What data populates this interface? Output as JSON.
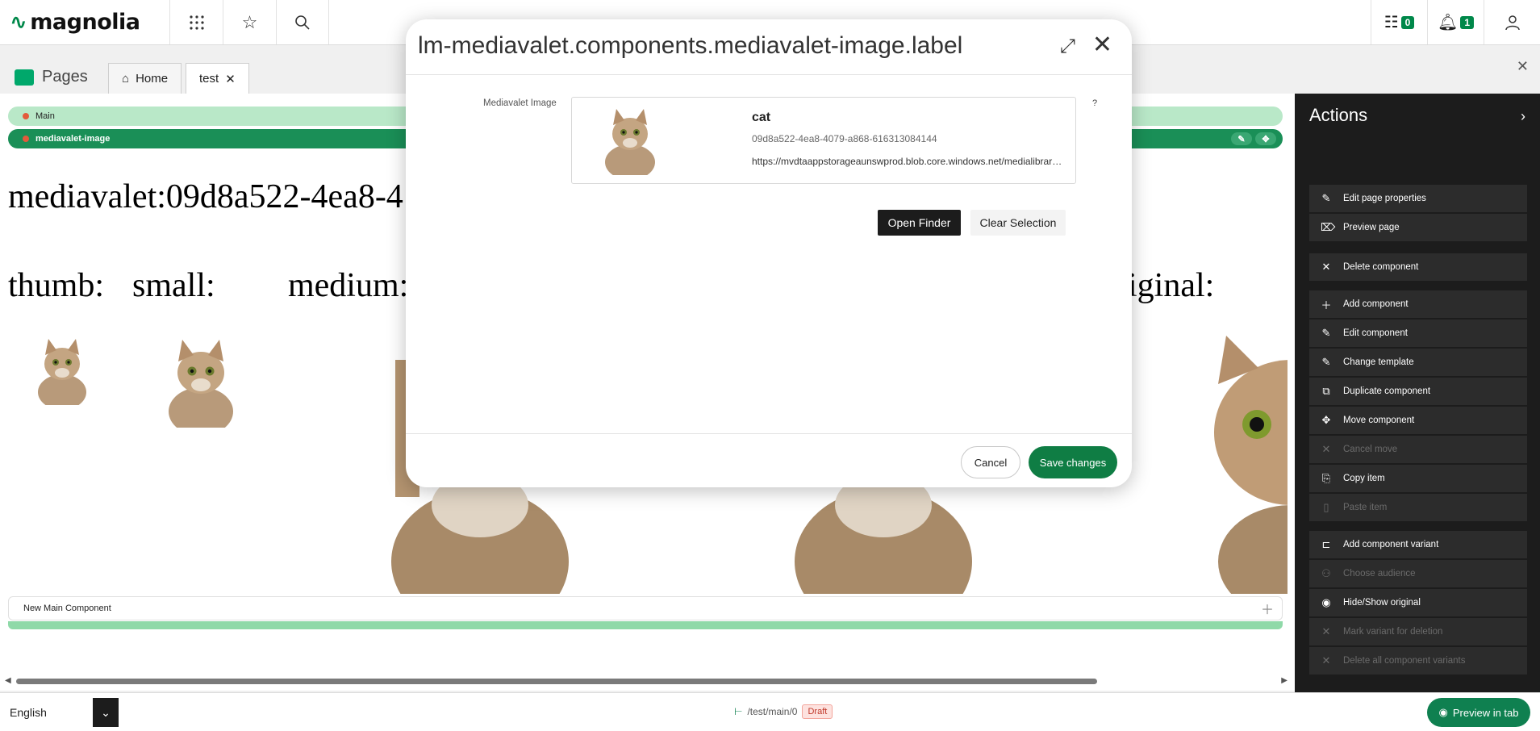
{
  "topbar": {
    "logo_text": "magnolia",
    "tasks_count": "0",
    "notifications_count": "1"
  },
  "tabs": {
    "app_title": "Pages",
    "home_label": "Home",
    "test_label": "test"
  },
  "canvas": {
    "main_area_label": "Main",
    "component_label": "mediavalet-image",
    "mediavalet_text": "mediavalet:09d8a522-4ea8-4",
    "labels": {
      "thumb": "thumb:",
      "small": "small:",
      "medium": "medium:",
      "original": "iginal:"
    },
    "new_component_label": "New Main Component"
  },
  "dialog": {
    "title": "lm-mediavalet.components.mediavalet-image.label",
    "field_label": "Mediavalet Image",
    "help": "?",
    "asset_title": "cat",
    "asset_id": "09d8a522-4ea8-4079-a868-616313084144",
    "asset_url": "https://mvdtaappstorageaunswprod.blob.core.windows.net/medialibrary/cat.jpg",
    "open_finder": "Open Finder",
    "clear_selection": "Clear Selection",
    "cancel": "Cancel",
    "save": "Save changes"
  },
  "actions": {
    "title": "Actions",
    "group1": [
      {
        "label": "Edit page properties",
        "icon": "pencil-icon"
      },
      {
        "label": "Preview page",
        "icon": "tag-icon"
      }
    ],
    "group2": [
      {
        "label": "Delete component",
        "icon": "close-icon"
      }
    ],
    "group3": [
      {
        "label": "Add component",
        "icon": "plus-icon"
      },
      {
        "label": "Edit component",
        "icon": "pencil-icon"
      },
      {
        "label": "Change template",
        "icon": "pencil-icon"
      },
      {
        "label": "Duplicate component",
        "icon": "duplicate-icon"
      },
      {
        "label": "Move component",
        "icon": "move-icon"
      },
      {
        "label": "Cancel move",
        "icon": "close-icon"
      },
      {
        "label": "Copy item",
        "icon": "copy-icon"
      },
      {
        "label": "Paste item",
        "icon": "paste-icon"
      }
    ],
    "group4": [
      {
        "label": "Add component variant",
        "icon": "variant-icon"
      },
      {
        "label": "Choose audience",
        "icon": "audience-icon"
      },
      {
        "label": "Hide/Show original",
        "icon": "eye-icon"
      },
      {
        "label": "Mark variant for deletion",
        "icon": "close-icon"
      },
      {
        "label": "Delete all component variants",
        "icon": "close-icon"
      }
    ]
  },
  "footer": {
    "language": "English",
    "path": "/test/main/0",
    "status": "Draft",
    "preview_in_tab": "Preview in tab"
  }
}
